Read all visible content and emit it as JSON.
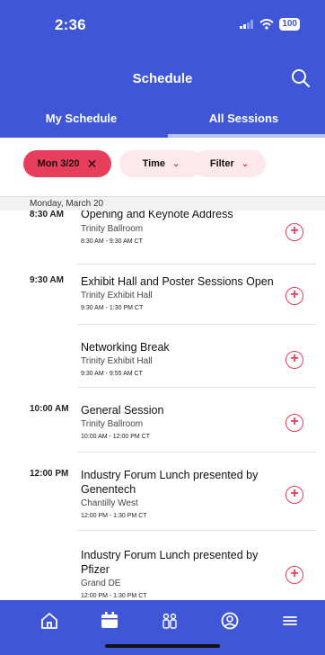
{
  "status": {
    "time": "2:36",
    "battery": "100"
  },
  "header": {
    "title": "Schedule"
  },
  "tabs": [
    {
      "label": "My Schedule"
    },
    {
      "label": "All Sessions"
    }
  ],
  "filters": {
    "date_label": "Mon 3/20",
    "time_label": "Time",
    "filter_label": "Filter"
  },
  "day": {
    "label": "Monday, March 20"
  },
  "sessions": [
    {
      "time": "8:30 AM",
      "title": "Opening and Keynote Address",
      "room": "Trinity Ballroom",
      "hours": "8:30 AM - 9:30 AM CT"
    },
    {
      "time": "9:30 AM",
      "title": "Exhibit Hall and Poster Sessions Open",
      "room": "Trinity Exhibit Hall",
      "hours": "9:30 AM - 1:30 PM CT"
    },
    {
      "time": "",
      "title": "Networking Break",
      "room": "Trinity Exhibit Hall",
      "hours": "9:30 AM - 9:55 AM CT"
    },
    {
      "time": "10:00 AM",
      "title": "General Session",
      "room": "Trinity Ballroom",
      "hours": "10:00 AM - 12:00 PM CT"
    },
    {
      "time": "12:00 PM",
      "title": "Industry Forum Lunch presented by Genentech",
      "room": "Chantilly West",
      "hours": "12:00 PM - 1:30 PM CT"
    },
    {
      "time": "",
      "title": "Industry Forum Lunch presented by Pfizer",
      "room": "Grand DE",
      "hours": "12:00 PM - 1:30 PM CT"
    }
  ],
  "icons": {
    "add": "plus-circle-icon",
    "nav": [
      "home-icon",
      "calendar-icon",
      "people-icon",
      "profile-icon",
      "menu-icon"
    ]
  },
  "colors": {
    "primary": "#3f57d6",
    "accent": "#e73e5b",
    "chip_bg": "#fde9ec"
  }
}
